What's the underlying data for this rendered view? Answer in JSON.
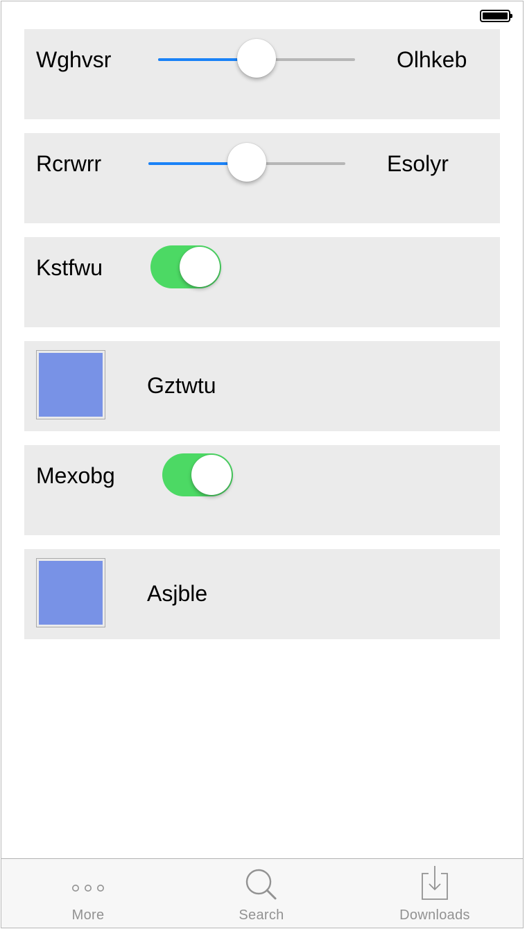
{
  "colors": {
    "row_background": "#ebebeb",
    "slider_accent": "#1a82f7",
    "toggle_on": "#4cd964",
    "swatch_color": "#7892e6",
    "tab_inactive": "#929292"
  },
  "rows": [
    {
      "type": "slider",
      "label": "Wghvsr",
      "max_label": "Olhkeb",
      "value": 0.5
    },
    {
      "type": "slider",
      "label": "Rcrwrr",
      "max_label": "Esolyr",
      "value": 0.5
    },
    {
      "type": "toggle",
      "label": "Kstfwu",
      "on": true
    },
    {
      "type": "swatch",
      "label": "Gztwtu",
      "color": "#7892e6"
    },
    {
      "type": "toggle",
      "label": "Mexobg",
      "on": true
    },
    {
      "type": "swatch",
      "label": "Asjble",
      "color": "#7892e6"
    }
  ],
  "tabbar": {
    "items": [
      {
        "label": "More",
        "icon": "more-icon"
      },
      {
        "label": "Search",
        "icon": "search-icon"
      },
      {
        "label": "Downloads",
        "icon": "downloads-icon"
      }
    ]
  }
}
